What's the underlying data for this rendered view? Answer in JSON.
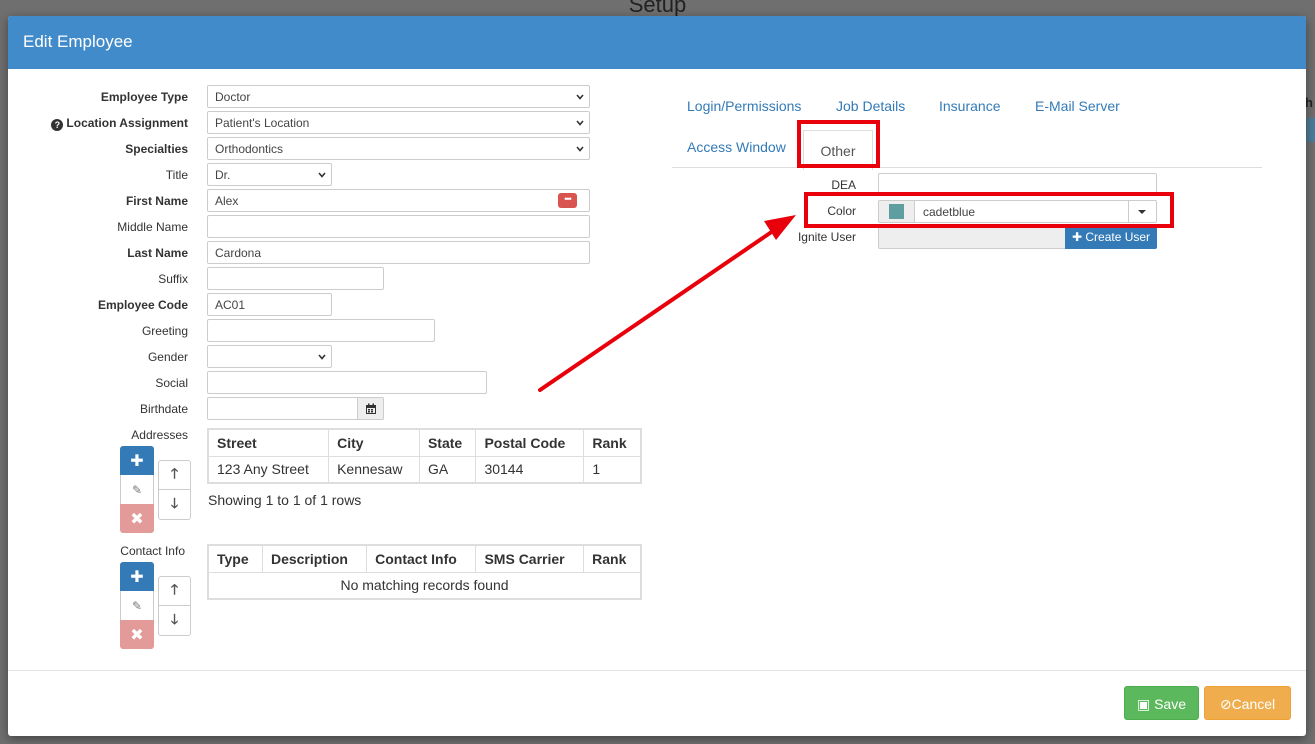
{
  "background": {
    "title": "Setup",
    "right_letter": "h"
  },
  "modal": {
    "title": "Edit Employee"
  },
  "form": {
    "employee_type": {
      "label": "Employee Type",
      "value": "Doctor"
    },
    "location_assignment": {
      "label": "Location Assignment",
      "value": "Patient's Location"
    },
    "specialties": {
      "label": "Specialties",
      "value": "Orthodontics"
    },
    "title": {
      "label": "Title",
      "value": "Dr."
    },
    "first_name": {
      "label": "First Name",
      "value": "Alex"
    },
    "middle_name": {
      "label": "Middle Name",
      "value": ""
    },
    "last_name": {
      "label": "Last Name",
      "value": "Cardona"
    },
    "suffix": {
      "label": "Suffix",
      "value": ""
    },
    "employee_code": {
      "label": "Employee Code",
      "value": "AC01"
    },
    "greeting": {
      "label": "Greeting",
      "value": ""
    },
    "gender": {
      "label": "Gender",
      "value": ""
    },
    "social": {
      "label": "Social",
      "value": ""
    },
    "birthdate": {
      "label": "Birthdate",
      "value": ""
    }
  },
  "addresses": {
    "label": "Addresses",
    "columns": [
      "Street",
      "City",
      "State",
      "Postal Code",
      "Rank"
    ],
    "rows": [
      [
        "123 Any Street",
        "Kennesaw",
        "GA",
        "30144",
        "1"
      ]
    ],
    "showing": "Showing 1 to 1 of 1 rows"
  },
  "contact_info": {
    "label": "Contact Info",
    "columns": [
      "Type",
      "Description",
      "Contact Info",
      "SMS Carrier",
      "Rank"
    ],
    "empty_message": "No matching records found"
  },
  "tabs": {
    "login": "Login/Permissions",
    "job_details": "Job Details",
    "insurance": "Insurance",
    "email_server": "E-Mail Server",
    "access_window": "Access Window",
    "other": "Other"
  },
  "other_tab": {
    "dea_label": "DEA",
    "dea_value": "",
    "color_label": "Color",
    "color_value": "cadetblue",
    "color_hex": "#5f9ea0",
    "ignite_label": "Ignite User",
    "create_user": "Create User"
  },
  "footer": {
    "save": "Save",
    "cancel": "Cancel"
  },
  "colors": {
    "header": "#428bca",
    "highlight": "#e8000b",
    "save": "#5cb85c",
    "cancel": "#f0ad4e"
  }
}
